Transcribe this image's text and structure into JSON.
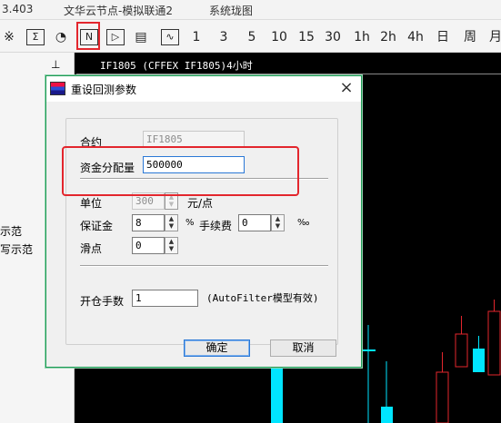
{
  "topbar": {
    "left": "3.403",
    "title": "文华云节点-模拟联通2",
    "system": "系统珑图"
  },
  "toolbar": {
    "items": [
      {
        "label": "※"
      },
      {
        "label": "Σ"
      },
      {
        "label": "◔"
      },
      {
        "label": "N"
      },
      {
        "label": "▷"
      },
      {
        "label": "▤"
      },
      {
        "label": "∿"
      },
      {
        "label": "1"
      },
      {
        "label": "3"
      },
      {
        "label": "5"
      },
      {
        "label": "10"
      },
      {
        "label": "15"
      },
      {
        "label": "30"
      },
      {
        "label": "1h"
      },
      {
        "label": "2h"
      },
      {
        "label": "4h"
      },
      {
        "label": "日"
      },
      {
        "label": "周"
      },
      {
        "label": "月"
      }
    ]
  },
  "leftpanel": {
    "pin": "⊥",
    "line1": "示范",
    "line2": "写示范"
  },
  "chart": {
    "title": "IF1805  (CFFEX IF1805)4小时"
  },
  "dialog": {
    "title": "重设回测参数",
    "close": "×",
    "contract_label": "合约",
    "contract_value": "IF1805",
    "capital_label": "资金分配量",
    "capital_value": "500000",
    "unit_label": "单位",
    "unit_value": "300",
    "unit_suffix": "元/点",
    "margin_label": "保证金",
    "margin_value": "8",
    "margin_suffix": "%",
    "fee_label": "手续费",
    "fee_value": "0",
    "fee_suffix": "‰",
    "slippage_label": "滑点",
    "slippage_value": "0",
    "lots_label": "开仓手数",
    "lots_value": "1",
    "lots_note": "(AutoFilter模型有效)",
    "ok": "确定",
    "cancel": "取消"
  }
}
